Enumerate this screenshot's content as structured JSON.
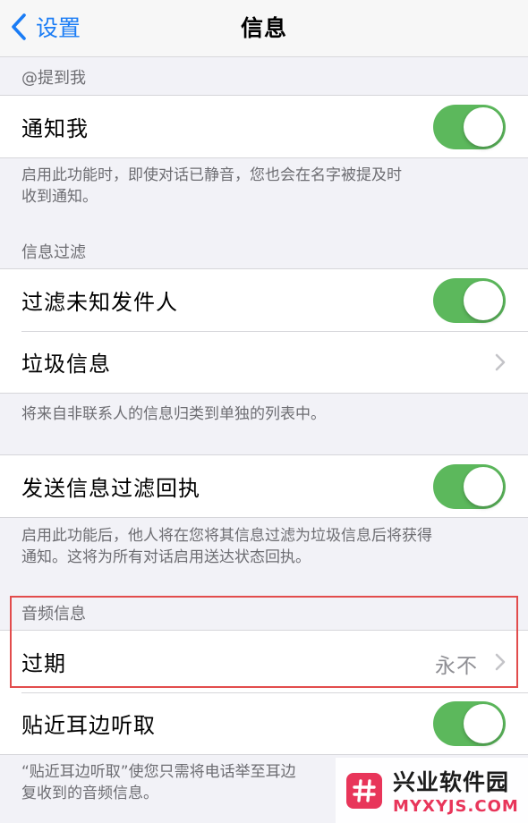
{
  "nav": {
    "back_label": "设置",
    "title": "信息"
  },
  "mention": {
    "header": "@提到我",
    "notify_label": "通知我",
    "notify_on": true,
    "footer_line1": "启用此功能时，即使对话已静音，您也会在名字被提及时",
    "footer_line2": "收到通知。"
  },
  "filter": {
    "header": "信息过滤",
    "filter_unknown_label": "过滤未知发件人",
    "filter_unknown_on": true,
    "junk_label": "垃圾信息",
    "footer": "将来自非联系人的信息归类到单独的列表中。"
  },
  "receipt": {
    "label": "发送信息过滤回执",
    "on": true,
    "footer_line1": "启用此功能后，他人将在您将其信息过滤为垃圾信息后将获得",
    "footer_line2": "通知。这将为所有对话启用送达状态回执。"
  },
  "audio": {
    "header": "音频信息",
    "expire_label": "过期",
    "expire_value": "永不",
    "raise_label": "贴近耳边听取",
    "raise_on": true,
    "footer_line1": "“贴近耳边听取”使您只需将电话举至耳边",
    "footer_line2": "复收到的音频信息。"
  },
  "watermark": {
    "cn": "兴业软件园",
    "en": "MYXYJS.COM"
  },
  "colors": {
    "accent": "#1a7cf5",
    "toggle_on": "#5cb85c",
    "highlight": "#e24c4c",
    "watermark": "#e8355a"
  },
  "icons": [
    "chevron-left-icon",
    "chevron-right-icon",
    "hash-logo-icon"
  ]
}
